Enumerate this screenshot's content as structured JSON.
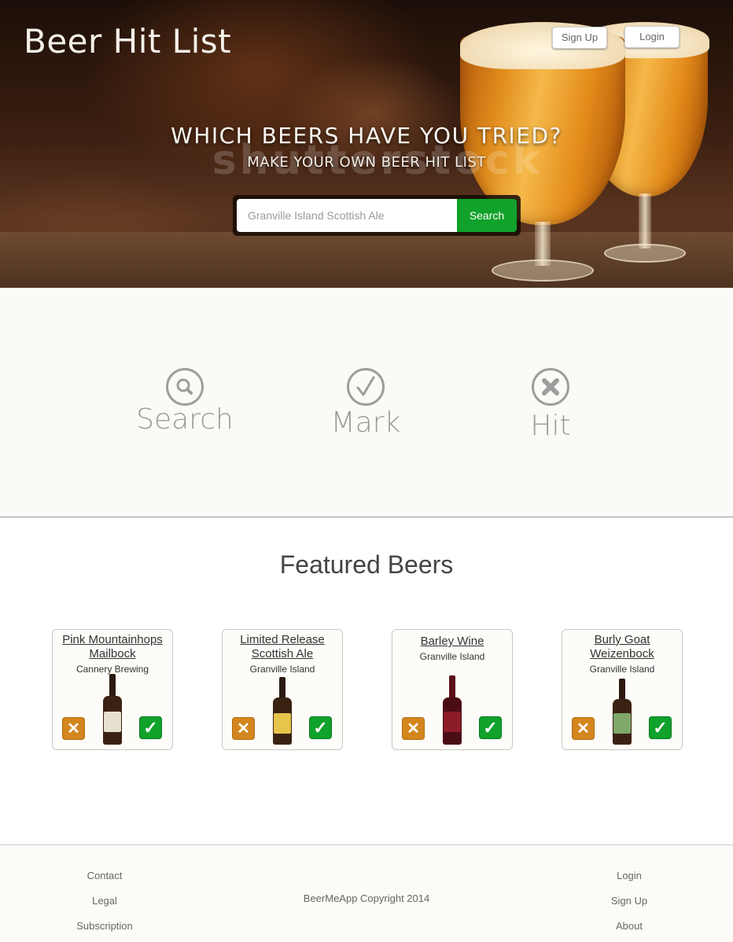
{
  "header": {
    "brand": "Beer Hit List",
    "signup_label": "Sign Up",
    "login_label": "Login"
  },
  "hero": {
    "headline": "WHICH BEERS HAVE YOU TRIED?",
    "subline": "MAKE YOUR OWN BEER HIT LIST",
    "watermark": "shutterstock",
    "search_placeholder": "Granville Island Scottish Ale",
    "search_button": "Search"
  },
  "steps": [
    {
      "label": "Search",
      "icon": "magnifier-icon"
    },
    {
      "label": "Mark",
      "icon": "check-icon"
    },
    {
      "label": "Hit",
      "icon": "cross-icon"
    }
  ],
  "featured": {
    "title": "Featured Beers",
    "beers": [
      {
        "name": "Pink Mountainhops Mailbock",
        "brewery": "Cannery Brewing",
        "label_color": "#e8e0cf"
      },
      {
        "name": "Limited Release Scottish Ale",
        "brewery": "Granville Island",
        "label_color": "#e7c44a"
      },
      {
        "name": "Barley Wine",
        "brewery": "Granville Island",
        "label_color": "#8c1c28"
      },
      {
        "name": "Burly Goat Weizenbock",
        "brewery": "Granville Island",
        "label_color": "#7fa86a"
      }
    ],
    "reject_glyph": "✕",
    "accept_glyph": "✓"
  },
  "footer": {
    "left": [
      "Contact",
      "Legal",
      "Subscription"
    ],
    "right": [
      "Login",
      "Sign Up",
      "About"
    ],
    "copyright": "BeerMeApp Copyright 2014"
  },
  "colors": {
    "accent_green": "#10a22b",
    "reject_orange": "#d3861d"
  }
}
